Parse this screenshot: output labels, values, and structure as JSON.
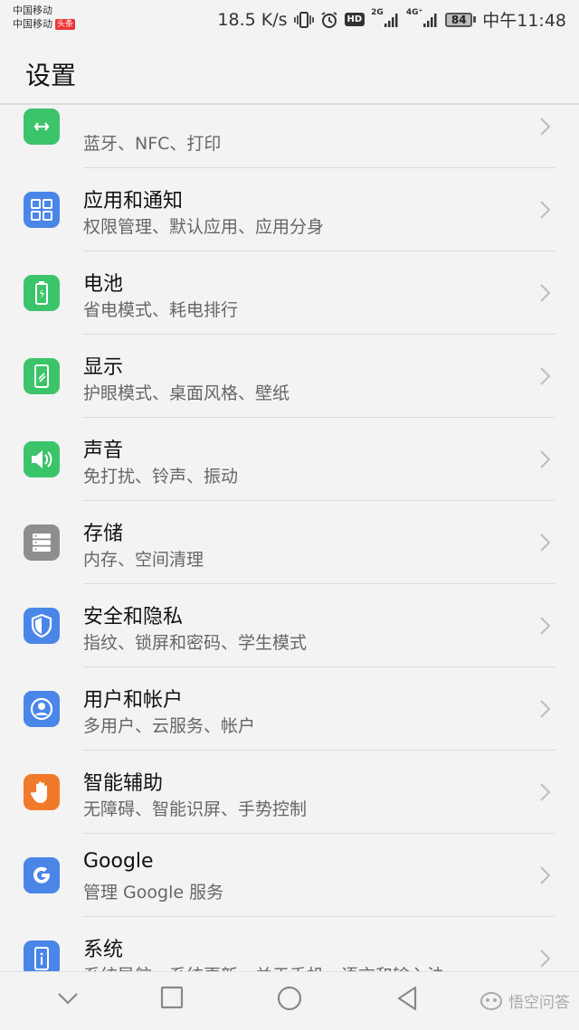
{
  "statusbar": {
    "carrier1": "中国移动",
    "carrier2": "中国移动",
    "badge": "头条",
    "speed": "18.5 K/s",
    "hd": "HD",
    "net1": "2G",
    "net2": "4G⁺",
    "battery": "84",
    "time": "中午11:48"
  },
  "header": {
    "title": "设置"
  },
  "settings": [
    {
      "title": "",
      "subtitle": "蓝牙、NFC、打印",
      "icon": "device-connection-icon",
      "color": "#3cc46b"
    },
    {
      "title": "应用和通知",
      "subtitle": "权限管理、默认应用、应用分身",
      "icon": "apps-icon",
      "color": "#4a86e8"
    },
    {
      "title": "电池",
      "subtitle": "省电模式、耗电排行",
      "icon": "battery-icon",
      "color": "#3cc46b"
    },
    {
      "title": "显示",
      "subtitle": "护眼模式、桌面风格、壁纸",
      "icon": "display-icon",
      "color": "#3cc46b"
    },
    {
      "title": "声音",
      "subtitle": "免打扰、铃声、振动",
      "icon": "speaker-icon",
      "color": "#3cc46b"
    },
    {
      "title": "存储",
      "subtitle": "内存、空间清理",
      "icon": "storage-icon",
      "color": "#8e8e8e"
    },
    {
      "title": "安全和隐私",
      "subtitle": "指纹、锁屏和密码、学生模式",
      "icon": "shield-icon",
      "color": "#4a86e8"
    },
    {
      "title": "用户和帐户",
      "subtitle": "多用户、云服务、帐户",
      "icon": "user-icon",
      "color": "#4a86e8"
    },
    {
      "title": "智能辅助",
      "subtitle": "无障碍、智能识屏、手势控制",
      "icon": "hand-icon",
      "color": "#f07a2a"
    },
    {
      "title": "Google",
      "subtitle": "管理 Google 服务",
      "icon": "google-icon",
      "color": "#4a86e8"
    },
    {
      "title": "系统",
      "subtitle": "系统导航、系统更新、关于手机、语言和输入法",
      "icon": "system-info-icon",
      "color": "#4a86e8"
    }
  ],
  "navbar": {
    "icons": [
      "chevron-down-icon",
      "recents-square-icon",
      "home-circle-icon",
      "back-triangle-icon"
    ]
  },
  "watermark": {
    "text": "悟空问答"
  }
}
